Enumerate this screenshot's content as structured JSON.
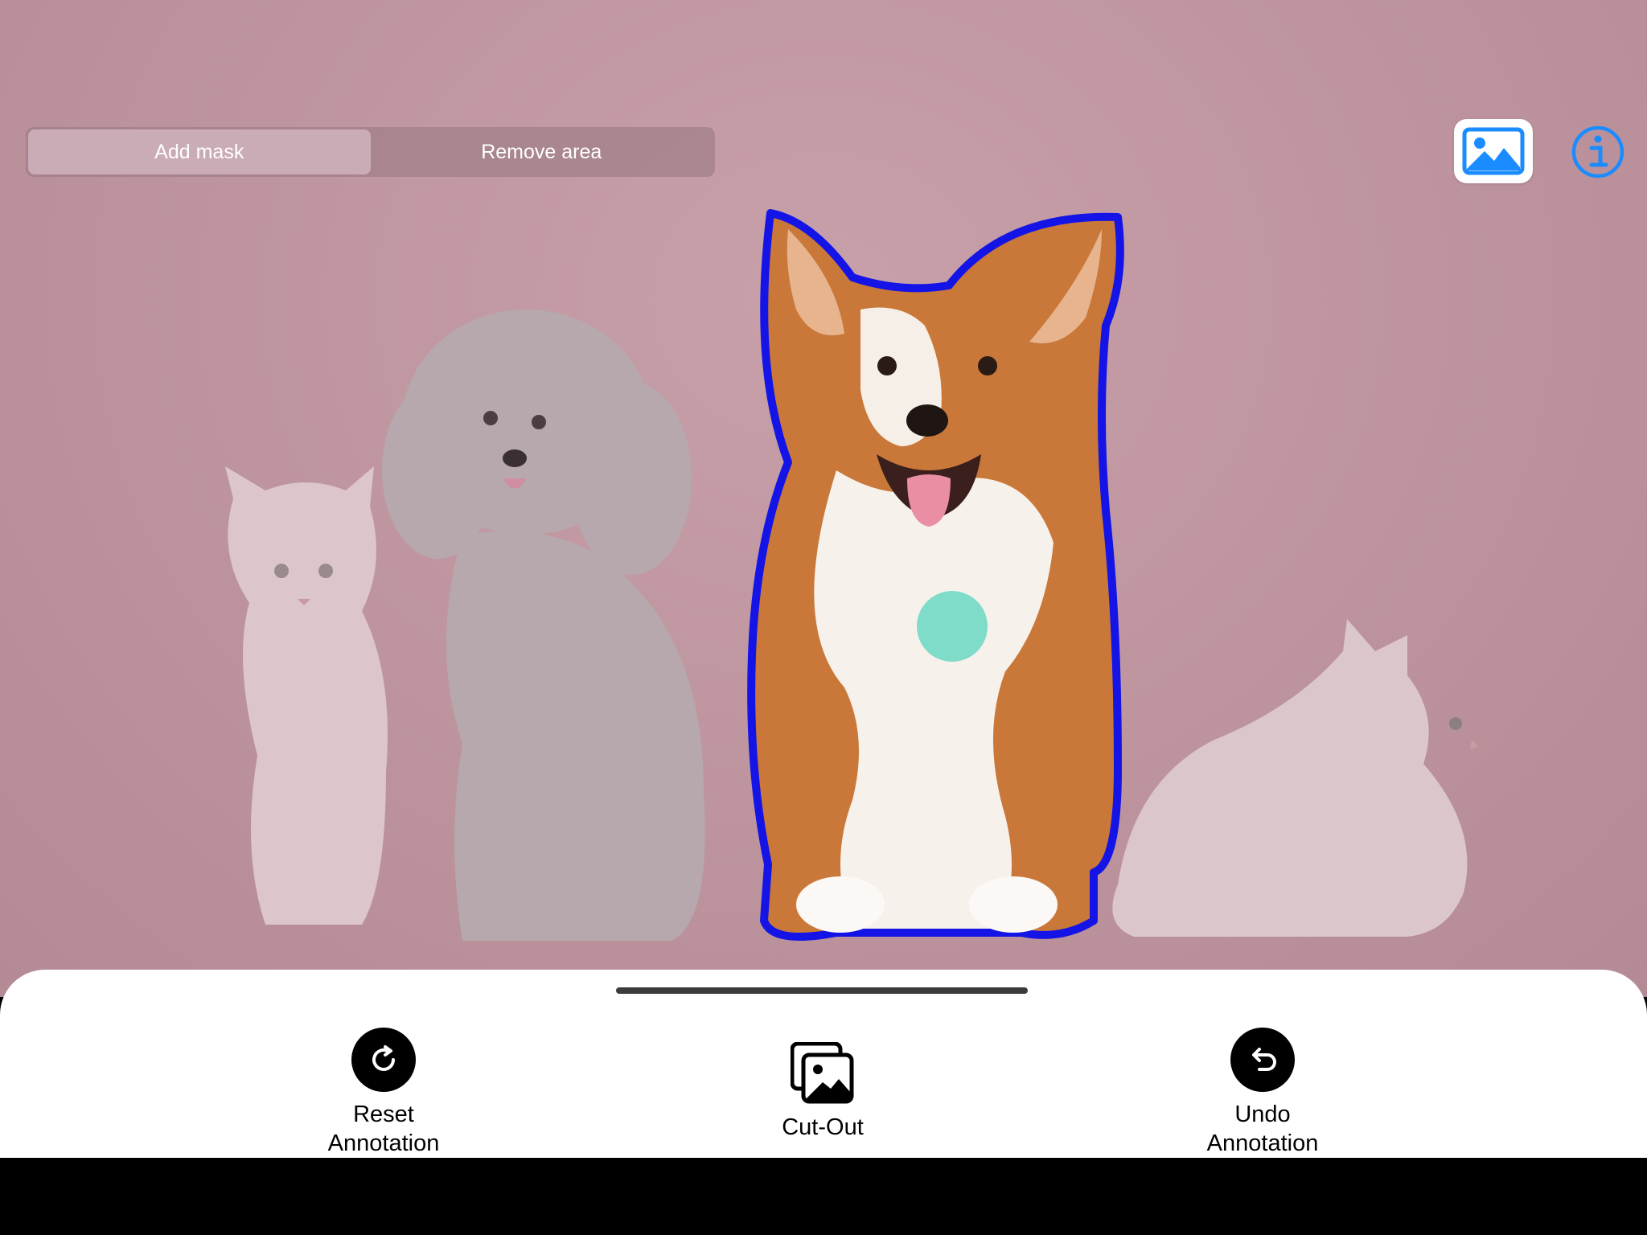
{
  "segmented_control": {
    "options": [
      {
        "label": "Add mask",
        "selected": true
      },
      {
        "label": "Remove area",
        "selected": false
      }
    ]
  },
  "top_actions": {
    "gallery_icon": "photo-gallery-icon",
    "info_icon": "info-icon"
  },
  "image": {
    "subjects": [
      "cat",
      "poodle",
      "corgi",
      "cat"
    ],
    "selected_subject": "corgi",
    "mask_outline_color": "#1414e6",
    "tap_point_color": "#7fdcc9"
  },
  "bottom_sheet": {
    "actions": [
      {
        "label": "Reset Annotation",
        "icon": "redo-circle-icon"
      },
      {
        "label": "Cut-Out",
        "icon": "photo-stack-icon"
      },
      {
        "label": "Undo Annotation",
        "icon": "undo-circle-icon"
      }
    ]
  },
  "colors": {
    "accent": "#1a8cff",
    "background": "#bf96a0"
  }
}
